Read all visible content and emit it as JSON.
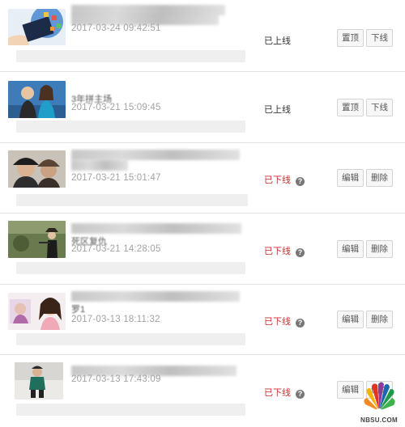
{
  "items": [
    {
      "thumb": "tablet-app-icons-photo",
      "title": "",
      "date": "2017-03-24 09:42:51",
      "status": "已上线",
      "status_type": "online",
      "btn1": "置顶",
      "btn2": "下线"
    },
    {
      "thumb": "couple-photo",
      "title": "3年拼主场",
      "date": "2017-03-21 15:09:45",
      "status": "已上线",
      "status_type": "online",
      "btn1": "置顶",
      "btn2": "下线"
    },
    {
      "thumb": "two-people-hats-photo",
      "title": "",
      "date": "2017-03-21 15:01:47",
      "status": "已下线",
      "status_type": "offline",
      "btn1": "编辑",
      "btn2": "删除"
    },
    {
      "thumb": "person-outdoor-photo",
      "title": "死区复仇",
      "date": "2017-03-21 14:28:05",
      "status": "已下线",
      "status_type": "offline",
      "btn1": "编辑",
      "btn2": "删除"
    },
    {
      "thumb": "woman-portrait-photo",
      "title": "罗1",
      "date": "2017-03-13 18:11:32",
      "status": "已下线",
      "status_type": "offline",
      "btn1": "编辑",
      "btn2": "删除"
    },
    {
      "thumb": "person-standing-photo",
      "title": "",
      "date": "2017-03-13 17:43:09",
      "status": "已下线",
      "status_type": "offline",
      "btn1": "编辑",
      "btn2": "删除"
    }
  ],
  "watermark": {
    "logo": "nbc-peacock-logo",
    "text": "NBSU.COM"
  },
  "colors": {
    "offline": "#c9302c",
    "online": "#333333",
    "date": "#a3a3a3",
    "button_border": "#d4d4d4"
  }
}
